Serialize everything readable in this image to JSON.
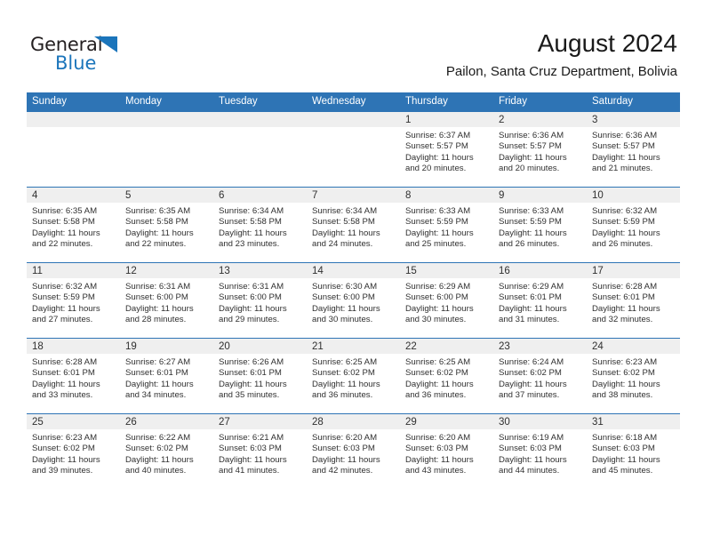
{
  "brand": {
    "name_part1": "General",
    "name_part2": "Blue",
    "triangle_color": "#1b75bb",
    "text_color": "#231f20"
  },
  "header": {
    "title": "August 2024",
    "subtitle": "Pailon, Santa Cruz Department, Bolivia"
  },
  "theme": {
    "header_blue": "#2e74b5",
    "daynum_band": "#efefef",
    "cell_background": "#ffffff",
    "text": "#303030"
  },
  "columns": [
    "Sunday",
    "Monday",
    "Tuesday",
    "Wednesday",
    "Thursday",
    "Friday",
    "Saturday"
  ],
  "weeks": [
    [
      {
        "day": "",
        "lines": []
      },
      {
        "day": "",
        "lines": []
      },
      {
        "day": "",
        "lines": []
      },
      {
        "day": "",
        "lines": []
      },
      {
        "day": "1",
        "lines": [
          "Sunrise: 6:37 AM",
          "Sunset: 5:57 PM",
          "Daylight: 11 hours",
          "and 20 minutes."
        ]
      },
      {
        "day": "2",
        "lines": [
          "Sunrise: 6:36 AM",
          "Sunset: 5:57 PM",
          "Daylight: 11 hours",
          "and 20 minutes."
        ]
      },
      {
        "day": "3",
        "lines": [
          "Sunrise: 6:36 AM",
          "Sunset: 5:57 PM",
          "Daylight: 11 hours",
          "and 21 minutes."
        ]
      }
    ],
    [
      {
        "day": "4",
        "lines": [
          "Sunrise: 6:35 AM",
          "Sunset: 5:58 PM",
          "Daylight: 11 hours",
          "and 22 minutes."
        ]
      },
      {
        "day": "5",
        "lines": [
          "Sunrise: 6:35 AM",
          "Sunset: 5:58 PM",
          "Daylight: 11 hours",
          "and 22 minutes."
        ]
      },
      {
        "day": "6",
        "lines": [
          "Sunrise: 6:34 AM",
          "Sunset: 5:58 PM",
          "Daylight: 11 hours",
          "and 23 minutes."
        ]
      },
      {
        "day": "7",
        "lines": [
          "Sunrise: 6:34 AM",
          "Sunset: 5:58 PM",
          "Daylight: 11 hours",
          "and 24 minutes."
        ]
      },
      {
        "day": "8",
        "lines": [
          "Sunrise: 6:33 AM",
          "Sunset: 5:59 PM",
          "Daylight: 11 hours",
          "and 25 minutes."
        ]
      },
      {
        "day": "9",
        "lines": [
          "Sunrise: 6:33 AM",
          "Sunset: 5:59 PM",
          "Daylight: 11 hours",
          "and 26 minutes."
        ]
      },
      {
        "day": "10",
        "lines": [
          "Sunrise: 6:32 AM",
          "Sunset: 5:59 PM",
          "Daylight: 11 hours",
          "and 26 minutes."
        ]
      }
    ],
    [
      {
        "day": "11",
        "lines": [
          "Sunrise: 6:32 AM",
          "Sunset: 5:59 PM",
          "Daylight: 11 hours",
          "and 27 minutes."
        ]
      },
      {
        "day": "12",
        "lines": [
          "Sunrise: 6:31 AM",
          "Sunset: 6:00 PM",
          "Daylight: 11 hours",
          "and 28 minutes."
        ]
      },
      {
        "day": "13",
        "lines": [
          "Sunrise: 6:31 AM",
          "Sunset: 6:00 PM",
          "Daylight: 11 hours",
          "and 29 minutes."
        ]
      },
      {
        "day": "14",
        "lines": [
          "Sunrise: 6:30 AM",
          "Sunset: 6:00 PM",
          "Daylight: 11 hours",
          "and 30 minutes."
        ]
      },
      {
        "day": "15",
        "lines": [
          "Sunrise: 6:29 AM",
          "Sunset: 6:00 PM",
          "Daylight: 11 hours",
          "and 30 minutes."
        ]
      },
      {
        "day": "16",
        "lines": [
          "Sunrise: 6:29 AM",
          "Sunset: 6:01 PM",
          "Daylight: 11 hours",
          "and 31 minutes."
        ]
      },
      {
        "day": "17",
        "lines": [
          "Sunrise: 6:28 AM",
          "Sunset: 6:01 PM",
          "Daylight: 11 hours",
          "and 32 minutes."
        ]
      }
    ],
    [
      {
        "day": "18",
        "lines": [
          "Sunrise: 6:28 AM",
          "Sunset: 6:01 PM",
          "Daylight: 11 hours",
          "and 33 minutes."
        ]
      },
      {
        "day": "19",
        "lines": [
          "Sunrise: 6:27 AM",
          "Sunset: 6:01 PM",
          "Daylight: 11 hours",
          "and 34 minutes."
        ]
      },
      {
        "day": "20",
        "lines": [
          "Sunrise: 6:26 AM",
          "Sunset: 6:01 PM",
          "Daylight: 11 hours",
          "and 35 minutes."
        ]
      },
      {
        "day": "21",
        "lines": [
          "Sunrise: 6:25 AM",
          "Sunset: 6:02 PM",
          "Daylight: 11 hours",
          "and 36 minutes."
        ]
      },
      {
        "day": "22",
        "lines": [
          "Sunrise: 6:25 AM",
          "Sunset: 6:02 PM",
          "Daylight: 11 hours",
          "and 36 minutes."
        ]
      },
      {
        "day": "23",
        "lines": [
          "Sunrise: 6:24 AM",
          "Sunset: 6:02 PM",
          "Daylight: 11 hours",
          "and 37 minutes."
        ]
      },
      {
        "day": "24",
        "lines": [
          "Sunrise: 6:23 AM",
          "Sunset: 6:02 PM",
          "Daylight: 11 hours",
          "and 38 minutes."
        ]
      }
    ],
    [
      {
        "day": "25",
        "lines": [
          "Sunrise: 6:23 AM",
          "Sunset: 6:02 PM",
          "Daylight: 11 hours",
          "and 39 minutes."
        ]
      },
      {
        "day": "26",
        "lines": [
          "Sunrise: 6:22 AM",
          "Sunset: 6:02 PM",
          "Daylight: 11 hours",
          "and 40 minutes."
        ]
      },
      {
        "day": "27",
        "lines": [
          "Sunrise: 6:21 AM",
          "Sunset: 6:03 PM",
          "Daylight: 11 hours",
          "and 41 minutes."
        ]
      },
      {
        "day": "28",
        "lines": [
          "Sunrise: 6:20 AM",
          "Sunset: 6:03 PM",
          "Daylight: 11 hours",
          "and 42 minutes."
        ]
      },
      {
        "day": "29",
        "lines": [
          "Sunrise: 6:20 AM",
          "Sunset: 6:03 PM",
          "Daylight: 11 hours",
          "and 43 minutes."
        ]
      },
      {
        "day": "30",
        "lines": [
          "Sunrise: 6:19 AM",
          "Sunset: 6:03 PM",
          "Daylight: 11 hours",
          "and 44 minutes."
        ]
      },
      {
        "day": "31",
        "lines": [
          "Sunrise: 6:18 AM",
          "Sunset: 6:03 PM",
          "Daylight: 11 hours",
          "and 45 minutes."
        ]
      }
    ]
  ]
}
